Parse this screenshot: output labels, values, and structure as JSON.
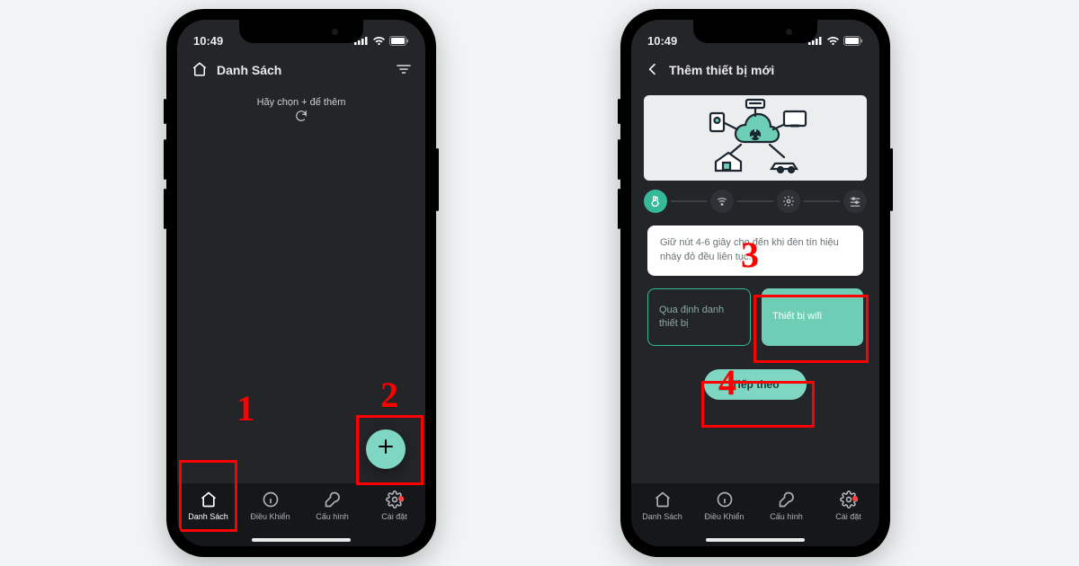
{
  "status": {
    "time": "10:49"
  },
  "common": {
    "tabs": [
      {
        "label": "Danh Sách"
      },
      {
        "label": "Điều Khiển"
      },
      {
        "label": "Cấu hình"
      },
      {
        "label": "Cài đặt"
      }
    ]
  },
  "left": {
    "header": "Danh Sách",
    "hint": "Hãy chọn + để thêm"
  },
  "right": {
    "header": "Thêm thiết bị mới",
    "instruction": "Giữ nút 4-6 giây cho đến khi đèn tín hiệu nháy đỏ đều liên tục.",
    "option_identify": "Qua định danh thiết bị",
    "option_wifi": "Thiết bị wifi",
    "next": "Tiếp theo"
  },
  "annotations": {
    "n1": "1",
    "n2": "2",
    "n3": "3",
    "n4": "4"
  }
}
